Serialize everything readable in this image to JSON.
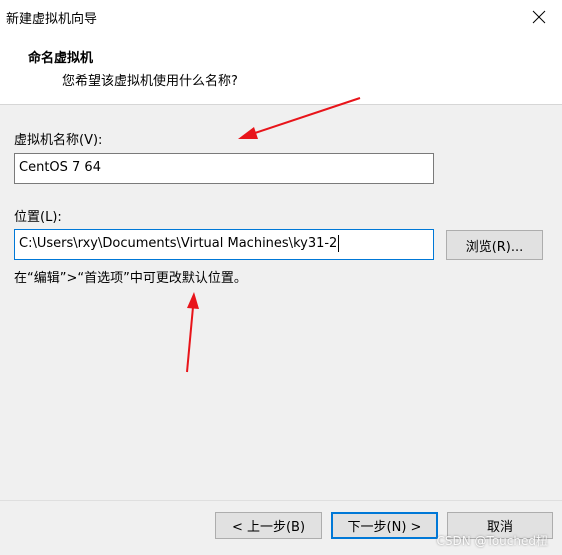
{
  "window": {
    "title": "新建虚拟机向导"
  },
  "header": {
    "title": "命名虚拟机",
    "subtitle": "您希望该虚拟机使用什么名称?"
  },
  "form": {
    "name_label": "虚拟机名称(V):",
    "name_value": "CentOS 7 64",
    "location_label": "位置(L):",
    "location_value": "C:\\Users\\rxy\\Documents\\Virtual Machines\\ky31-2",
    "browse_label": "浏览(R)...",
    "hint": "在“编辑”>“首选项”中可更改默认位置。"
  },
  "footer": {
    "back_label": "< 上一步(B)",
    "next_label": "下一步(N) >",
    "cancel_label": "取消"
  },
  "watermark": "CSDN @Touched杻",
  "colors": {
    "accent": "#0078d7",
    "annotation": "#e8141a"
  },
  "icons": {
    "close": "close-icon"
  }
}
